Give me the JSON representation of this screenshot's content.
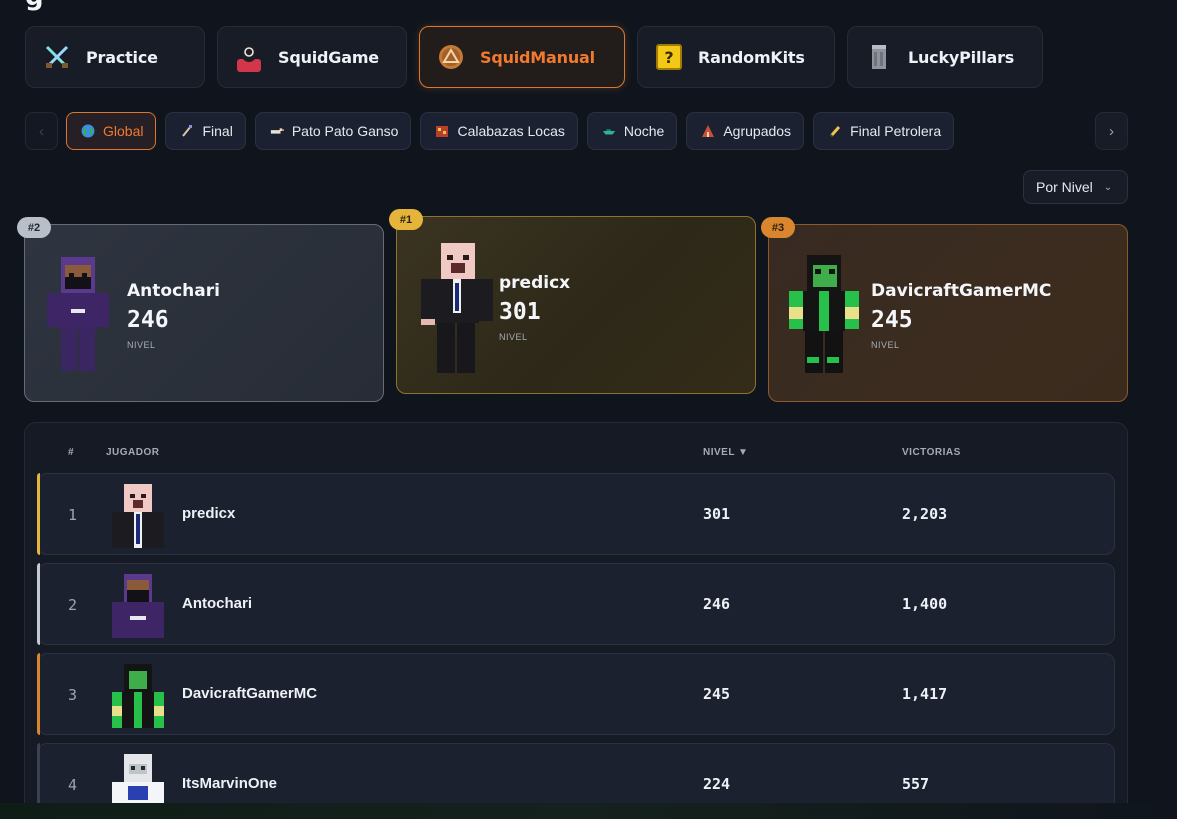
{
  "page": {
    "title_fragment": "g"
  },
  "game_tabs": [
    {
      "label": "Practice",
      "icon": "crossed-swords-icon",
      "active": false
    },
    {
      "label": "SquidGame",
      "icon": "squid-guard-icon",
      "active": false
    },
    {
      "label": "SquidManual",
      "icon": "triangle-coin-icon",
      "active": true
    },
    {
      "label": "RandomKits",
      "icon": "question-block-icon",
      "active": false
    },
    {
      "label": "LuckyPillars",
      "icon": "pillar-icon",
      "active": false
    }
  ],
  "modes": {
    "prev_icon": "‹",
    "next_icon": "›",
    "items": [
      {
        "label": "Global",
        "icon": "globe-icon",
        "active": true
      },
      {
        "label": "Final",
        "icon": "stick-icon",
        "active": false
      },
      {
        "label": "Pato Pato Ganso",
        "icon": "duck-icon",
        "active": false
      },
      {
        "label": "Calabazas Locas",
        "icon": "pumpkin-icon",
        "active": false
      },
      {
        "label": "Noche",
        "icon": "boat-icon",
        "active": false
      },
      {
        "label": "Agrupados",
        "icon": "tent-icon",
        "active": false
      },
      {
        "label": "Final Petrolera",
        "icon": "pencil-icon",
        "active": false
      }
    ]
  },
  "sort": {
    "label": "Por Nivel",
    "chevron": "⌄"
  },
  "podium": {
    "unit_label": "NIVEL",
    "places": [
      {
        "badge": "#2",
        "name": "Antochari",
        "value": "246"
      },
      {
        "badge": "#1",
        "name": "predicx",
        "value": "301"
      },
      {
        "badge": "#3",
        "name": "DavicraftGamerMC",
        "value": "245"
      }
    ]
  },
  "table": {
    "headers": {
      "rank": "#",
      "player": "JUGADOR",
      "level": "NIVEL ▼",
      "wins": "VICTORIAS"
    },
    "rows": [
      {
        "rank": "1",
        "name": "predicx",
        "level": "301",
        "wins": "2,203",
        "accent": "#e5b43a"
      },
      {
        "rank": "2",
        "name": "Antochari",
        "level": "246",
        "wins": "1,400",
        "accent": "#c3c8d1"
      },
      {
        "rank": "3",
        "name": "DavicraftGamerMC",
        "level": "245",
        "wins": "1,417",
        "accent": "#d9862f"
      },
      {
        "rank": "4",
        "name": "ItsMarvinOne",
        "level": "224",
        "wins": "557",
        "accent": "#3a4252"
      }
    ]
  }
}
